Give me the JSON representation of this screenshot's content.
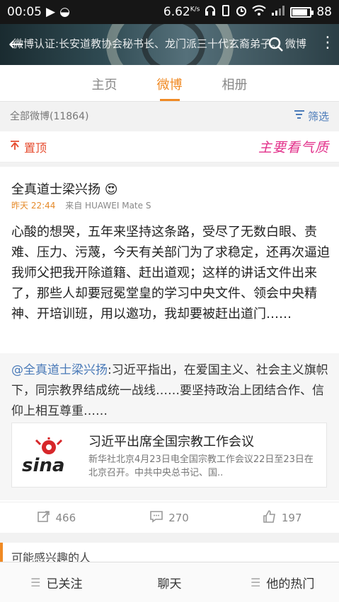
{
  "status_bar": {
    "time": "00:05",
    "speed": "6.62",
    "speed_unit": "K/s",
    "battery": "88",
    "battery_level": 0.88
  },
  "header": {
    "marquee": "微博认证:长安道教协会秘书长、龙门派三十代玄裔弟子。 微博"
  },
  "tabs": [
    {
      "label": "主页"
    },
    {
      "label": "微博"
    },
    {
      "label": "相册"
    }
  ],
  "filter": {
    "count_label": "全部微博(11864)",
    "filter_button": "筛选"
  },
  "pinned": {
    "label": "置顶",
    "sticker": "主要看气质"
  },
  "post": {
    "author": "全真道士梁兴扬",
    "time": "昨天 22:44",
    "source": "来自 HUAWEI Mate S",
    "body": "心酸的想哭，五年来坚持这条路，受尽了无数白眼、责难、压力、污蔑，今天有关部门为了求稳定，还再次逼迫我师父把我开除道籍、赶出道观；这样的讲话文件出来了，那些人却要冠冕堂皇的学习中央文件、领会中央精神、开培训班，用以邀功，我却要被赶出道门……",
    "repost": {
      "mention": "@全真道士梁兴扬",
      "text": ":习近平指出，在爱国主义、社会主义旗帜下，同宗教界结成统一战线……要坚持政治上团结合作、信仰上相互尊重……",
      "link_card": {
        "logo": "sina",
        "title": "习近平出席全国宗教工作会议",
        "desc": "新华社北京4月23日电全国宗教工作会议22日至23日在北京召开。中共中央总书记、国.."
      }
    },
    "actions": {
      "repost_count": "466",
      "comment_count": "270",
      "like_count": "197"
    }
  },
  "suggest": {
    "label": "可能感兴趣的人"
  },
  "bottom_nav": [
    {
      "label": "已关注"
    },
    {
      "label": "聊天"
    },
    {
      "label": "他的热门"
    }
  ],
  "colors": {
    "accent": "#f08a24",
    "link": "#4a7ab8",
    "pinned": "#e64b2e",
    "sticker": "#e2308a",
    "sina_red": "#d7272a"
  }
}
